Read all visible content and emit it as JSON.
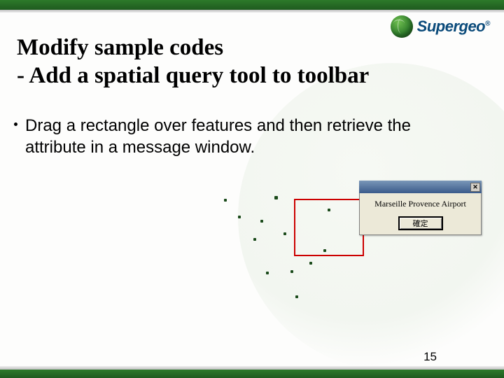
{
  "logo": {
    "text": "Supergeo",
    "registered": "®"
  },
  "title": {
    "line1": "Modify sample codes",
    "line2": "- Add a spatial query tool to toolbar"
  },
  "bullet": {
    "text": "Drag a rectangle over features and then retrieve the attribute in a message window."
  },
  "dialog": {
    "close": "✕",
    "message": "Marseille Provence Airport",
    "ok": "確定"
  },
  "pageNumber": "15"
}
